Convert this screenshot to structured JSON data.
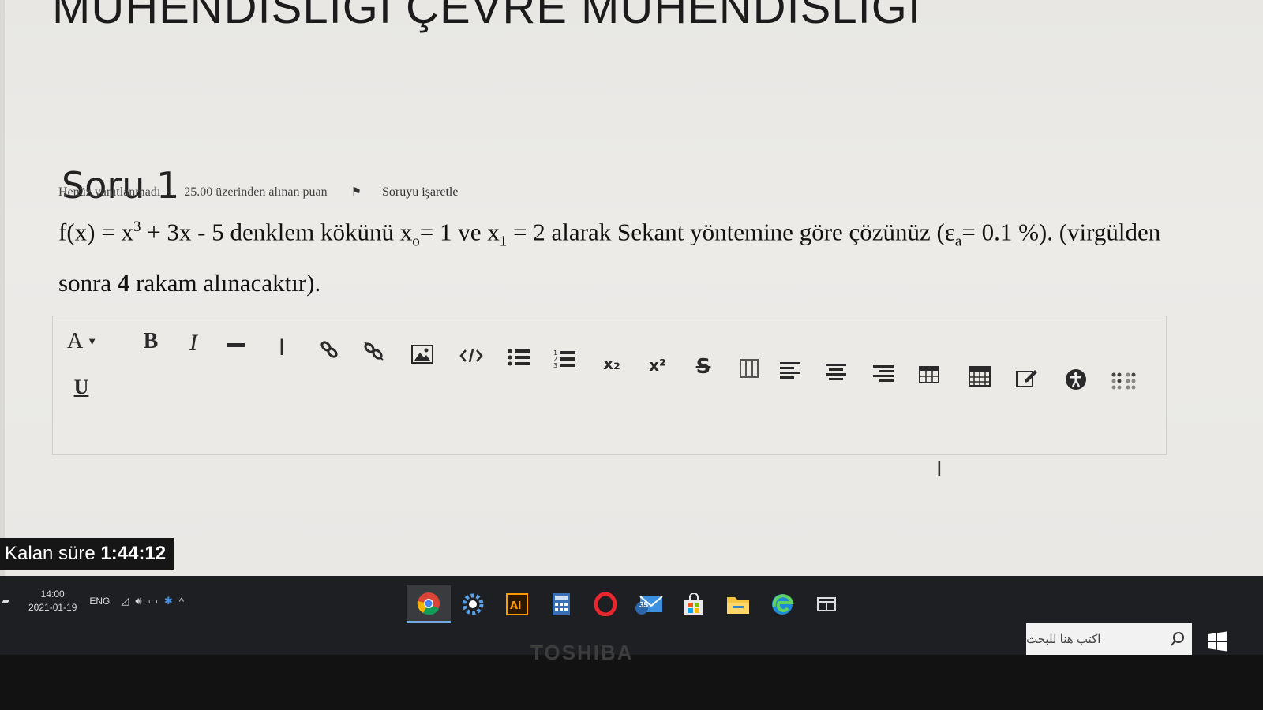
{
  "course": {
    "title": "MÜHENDİSLİĞİ ÇEVRE MÜHENDİSLİĞİ"
  },
  "question": {
    "title": "Soru 1",
    "info": {
      "status": "Henüz yanıtlanmadı",
      "points": "25.00 üzerinden alınan puan",
      "flag_label": "Soruyu işaretle"
    },
    "text": {
      "f": "f(x) = x",
      "exp3": "3",
      "rest1": " + 3x - 5 denklem kökünü x",
      "sub0": "o",
      "mid1": "= 1 ve x",
      "sub1": "1",
      "mid2": " = 2 alarak Sekant yöntemine göre çözünüz (ε",
      "suba": "a",
      "mid3": "= 0.1 %). (virgülden sonra ",
      "four": "4",
      "end": " rakam alınacaktır)."
    }
  },
  "toolbar": {
    "font_label": "A",
    "bold_label": "B",
    "italic_label": "I",
    "underline_label": "U",
    "subscript_label": "x₂",
    "superscript_label": "x²",
    "strike_label": "S"
  },
  "timer": {
    "label": "Kalan süre ",
    "value": "1:44:12"
  },
  "taskbar": {
    "time": "14:00",
    "date": "2021-01-19",
    "lang": "ENG",
    "mail_badge": "35",
    "search_placeholder": "اكتب هنا للبحث"
  },
  "brand": "TOSHIBA"
}
